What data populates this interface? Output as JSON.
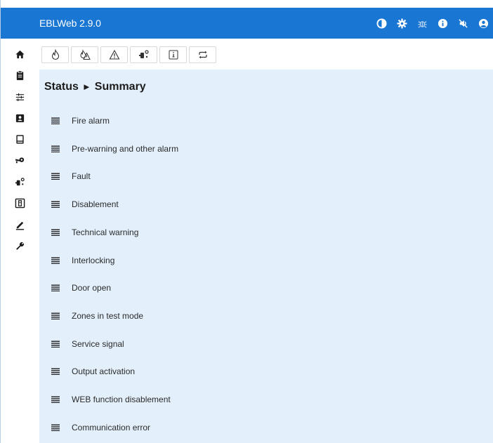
{
  "header": {
    "title": "EBLWeb 2.9.0",
    "icons": [
      "contrast-icon",
      "gear-icon",
      "bug-icon",
      "info-icon",
      "mute-icon",
      "user-icon"
    ]
  },
  "sidebar": {
    "items": [
      "home-icon",
      "clipboard-icon",
      "sliders-icon",
      "contact-card-icon",
      "panel-icon",
      "key-icon",
      "network-icon",
      "device-icon",
      "edit-icon",
      "wrench-icon"
    ]
  },
  "toolbar": {
    "buttons": [
      "fire-icon",
      "prewarning-icon",
      "warning-icon",
      "network-icon",
      "info-box-icon",
      "cycle-icon"
    ]
  },
  "breadcrumb": {
    "section": "Status",
    "separator": "►",
    "page": "Summary"
  },
  "summary": {
    "items": [
      "Fire alarm",
      "Pre-warning and other alarm",
      "Fault",
      "Disablement",
      "Technical warning",
      "Interlocking",
      "Door open",
      "Zones in test mode",
      "Service signal",
      "Output activation",
      "WEB function disablement",
      "Communication error"
    ]
  },
  "colors": {
    "header": "#1976d2",
    "content_bg": "#e3f0fc",
    "icon_dark": "#1c1c1c"
  }
}
